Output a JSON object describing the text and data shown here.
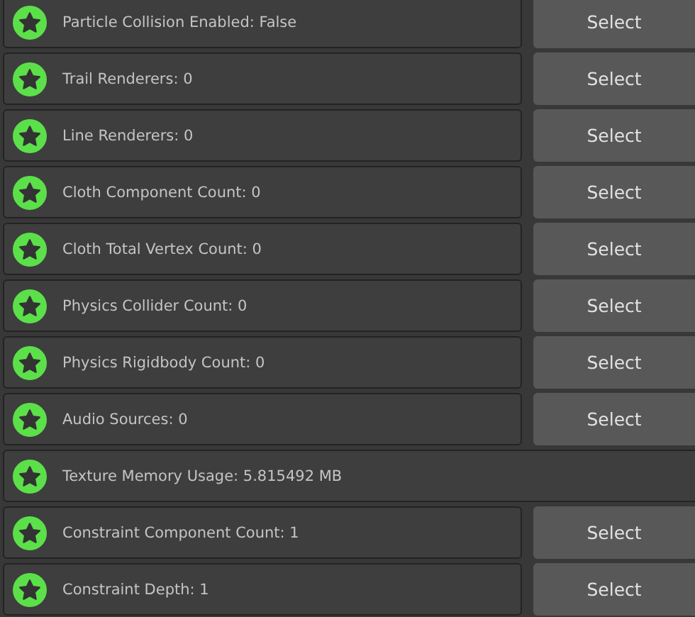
{
  "rows": [
    {
      "kind": "select",
      "label": "Particle Collision Enabled: False",
      "button": "Select"
    },
    {
      "kind": "select",
      "label": "Trail Renderers: 0",
      "button": "Select"
    },
    {
      "kind": "select",
      "label": "Line Renderers: 0",
      "button": "Select"
    },
    {
      "kind": "select",
      "label": "Cloth Component Count: 0",
      "button": "Select"
    },
    {
      "kind": "select",
      "label": "Cloth Total Vertex Count: 0",
      "button": "Select"
    },
    {
      "kind": "select",
      "label": "Physics Collider Count: 0",
      "button": "Select"
    },
    {
      "kind": "select",
      "label": "Physics Rigidbody Count: 0",
      "button": "Select"
    },
    {
      "kind": "select",
      "label": "Audio Sources: 0",
      "button": "Select"
    },
    {
      "kind": "info",
      "label": "Texture Memory Usage: 5.815492 MB"
    },
    {
      "kind": "select",
      "label": "Constraint Component Count: 1",
      "button": "Select"
    },
    {
      "kind": "select",
      "label": "Constraint Depth: 1",
      "button": "Select"
    }
  ]
}
